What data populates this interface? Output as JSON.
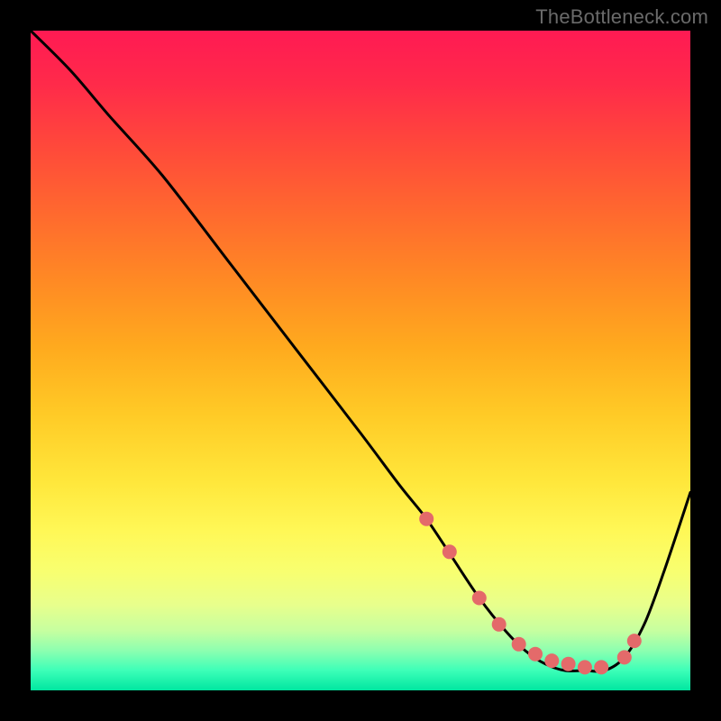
{
  "watermark": "TheBottleneck.com",
  "chart_data": {
    "type": "line",
    "title": "",
    "xlabel": "",
    "ylabel": "",
    "xlim": [
      0,
      100
    ],
    "ylim": [
      0,
      100
    ],
    "grid": false,
    "legend": null,
    "series": [
      {
        "name": "curve",
        "x": [
          0,
          6,
          12,
          20,
          30,
          40,
          50,
          56,
          60,
          64,
          68,
          72,
          75,
          78,
          81,
          84,
          87,
          90,
          93,
          96,
          100
        ],
        "values": [
          100,
          94,
          87,
          78,
          65,
          52,
          39,
          31,
          26,
          20,
          14,
          9,
          6,
          4,
          3,
          3,
          3,
          5,
          10,
          18,
          30
        ]
      }
    ],
    "markers": {
      "name": "dots",
      "color": "#e46a6a",
      "x": [
        60,
        63.5,
        68,
        71,
        74,
        76.5,
        79,
        81.5,
        84,
        86.5,
        90,
        91.5
      ],
      "values": [
        26,
        21,
        14,
        10,
        7,
        5.5,
        4.5,
        4,
        3.5,
        3.5,
        5,
        7.5
      ]
    }
  }
}
